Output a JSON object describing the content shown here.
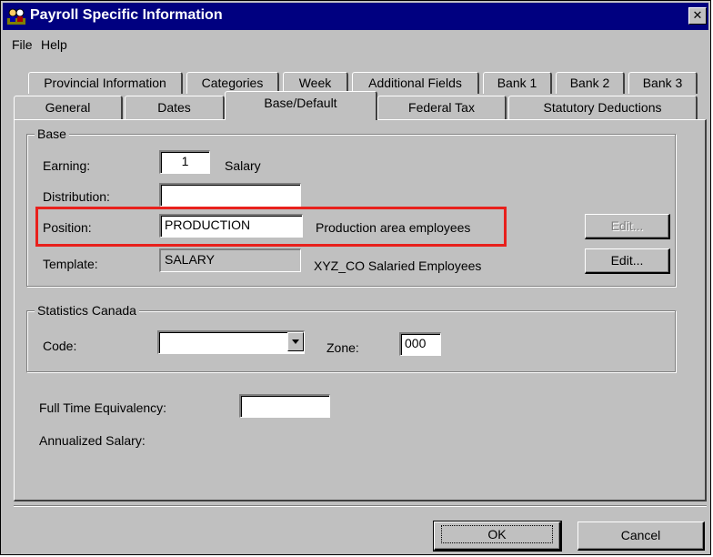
{
  "window": {
    "title": "Payroll Specific Information",
    "close_glyph": "✕"
  },
  "menu": [
    {
      "label": "File"
    },
    {
      "label": "Help"
    }
  ],
  "tabs_row1": [
    {
      "label": "Provincial Information"
    },
    {
      "label": "Categories"
    },
    {
      "label": "Week"
    },
    {
      "label": "Additional Fields"
    },
    {
      "label": "Bank 1"
    },
    {
      "label": "Bank 2"
    },
    {
      "label": "Bank 3"
    }
  ],
  "tabs_row2": [
    {
      "label": "General"
    },
    {
      "label": "Dates"
    },
    {
      "label": "Base/Default",
      "active": true
    },
    {
      "label": "Federal Tax"
    },
    {
      "label": "Statutory Deductions"
    }
  ],
  "base": {
    "group_title": "Base",
    "earning": {
      "label": "Earning:",
      "value": "1",
      "description": "Salary"
    },
    "distribution": {
      "label": "Distribution:",
      "value": ""
    },
    "position": {
      "label": "Position:",
      "value": "PRODUCTION",
      "description": "Production area employees",
      "edit_label": "Edit...",
      "edit_enabled": false
    },
    "template": {
      "label": "Template:",
      "value": "SALARY",
      "description": "XYZ_CO Salaried Employees",
      "edit_label": "Edit...",
      "edit_enabled": true
    }
  },
  "statistics": {
    "group_title": "Statistics Canada",
    "code": {
      "label": "Code:",
      "value": ""
    },
    "zone": {
      "label": "Zone:",
      "value": "000"
    }
  },
  "full_time_equivalency": {
    "label": "Full Time Equivalency:",
    "value": ""
  },
  "annualized_salary": {
    "label": "Annualized Salary:",
    "value": ""
  },
  "buttons": {
    "ok": "OK",
    "cancel": "Cancel"
  },
  "colors": {
    "titlebar": "#000080",
    "highlight": "#e8201c"
  },
  "icons": {
    "title": "payroll-people-icon",
    "dropdown": "chevron-down-icon",
    "close": "close-icon"
  }
}
